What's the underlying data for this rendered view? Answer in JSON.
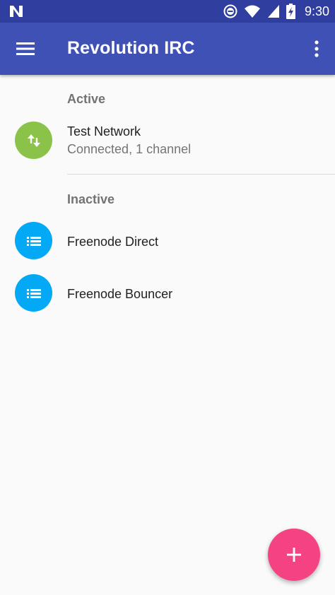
{
  "status_bar": {
    "time": "9:30",
    "icons": [
      "notification-n-icon",
      "do-not-disturb-icon",
      "wifi-icon",
      "cell-signal-icon",
      "battery-charging-icon"
    ]
  },
  "app_bar": {
    "title": "Revolution IRC",
    "menu_icon": "hamburger-menu-icon",
    "overflow_icon": "more-vert-icon",
    "color": "#3f51b5",
    "status_color": "#303f9f"
  },
  "sections": {
    "active": {
      "header": "Active",
      "items": [
        {
          "name": "Test Network",
          "status": "Connected, 1 channel",
          "icon": "swap-vert-icon",
          "color": "#8bc34a"
        }
      ]
    },
    "inactive": {
      "header": "Inactive",
      "items": [
        {
          "name": "Freenode Direct",
          "icon": "list-icon",
          "color": "#03a9f4"
        },
        {
          "name": "Freenode Bouncer",
          "icon": "list-icon",
          "color": "#03a9f4"
        }
      ]
    }
  },
  "fab": {
    "icon": "add-icon",
    "color": "#f44283"
  }
}
